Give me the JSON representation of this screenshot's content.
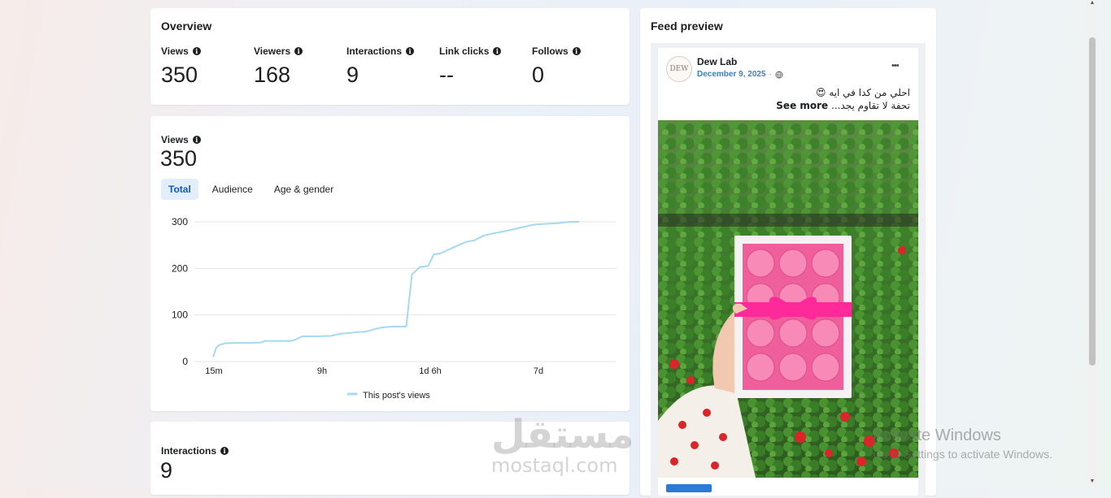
{
  "overview": {
    "title": "Overview",
    "metrics": [
      {
        "label": "Views",
        "value": "350"
      },
      {
        "label": "Viewers",
        "value": "168"
      },
      {
        "label": "Interactions",
        "value": "9"
      },
      {
        "label": "Link clicks",
        "value": "--"
      },
      {
        "label": "Follows",
        "value": "0"
      }
    ]
  },
  "views_panel": {
    "label": "Views",
    "value": "350",
    "tabs": [
      "Total",
      "Audience",
      "Age & gender"
    ],
    "active_tab": "Total",
    "legend": "This post's views"
  },
  "chart_data": {
    "type": "line",
    "x_tick_labels": [
      "15m",
      "9h",
      "1d 6h",
      "7d"
    ],
    "y_ticks": [
      0,
      100,
      200,
      300
    ],
    "ylim": [
      0,
      300
    ],
    "series": [
      {
        "name": "This post's views",
        "color": "#a8d8f0",
        "points": [
          [
            0,
            10
          ],
          [
            4,
            30
          ],
          [
            8,
            36
          ],
          [
            15,
            39
          ],
          [
            25,
            40
          ],
          [
            45,
            40
          ],
          [
            60,
            41
          ],
          [
            63,
            44
          ],
          [
            70,
            44
          ],
          [
            82,
            44
          ],
          [
            95,
            44
          ],
          [
            100,
            46
          ],
          [
            110,
            54
          ],
          [
            125,
            54
          ],
          [
            145,
            55
          ],
          [
            158,
            60
          ],
          [
            168,
            61
          ],
          [
            176,
            63
          ],
          [
            188,
            64
          ],
          [
            200,
            70
          ],
          [
            208,
            73
          ],
          [
            220,
            75
          ],
          [
            238,
            75
          ],
          [
            245,
            187
          ],
          [
            250,
            195
          ],
          [
            255,
            203
          ],
          [
            265,
            205
          ],
          [
            272,
            230
          ],
          [
            280,
            232
          ],
          [
            300,
            248
          ],
          [
            312,
            257
          ],
          [
            322,
            260
          ],
          [
            333,
            270
          ],
          [
            345,
            275
          ],
          [
            360,
            280
          ],
          [
            380,
            288
          ],
          [
            396,
            294
          ],
          [
            415,
            296
          ],
          [
            425,
            297
          ],
          [
            434,
            299
          ],
          [
            441,
            300
          ],
          [
            445,
            300
          ],
          [
            451,
            300
          ]
        ]
      }
    ]
  },
  "interactions_panel": {
    "label": "Interactions",
    "value": "9"
  },
  "feed_preview": {
    "title": "Feed preview",
    "page_name": "Dew Lab",
    "avatar_text": "DEW",
    "date": "December 9, 2025",
    "caption_line1": "احلي من كدا في ايه 😍",
    "caption_line2_prefix": "تحفة لا تقاوم يجد... ",
    "see_more": "See more",
    "more_icon": "•••"
  },
  "watermark": {
    "arabic": "مستقل",
    "latin": "mostaql.com"
  },
  "os_overlay": {
    "activate_title": "Activate Windows",
    "activate_sub": "Go to Settings to activate Windows."
  },
  "colors": {
    "accent": "#0a5cbf",
    "line": "#a8d8f0",
    "grid": "#e4e6eb"
  }
}
